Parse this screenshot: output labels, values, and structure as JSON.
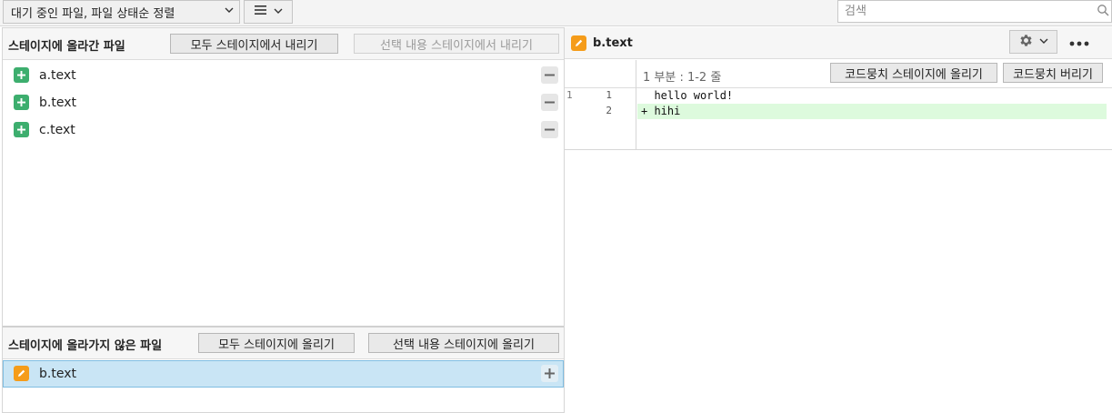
{
  "toolbar": {
    "sort_label": "대기 중인 파일, 파일 상태순 정렬",
    "view_icon_name": "list-icon",
    "search_placeholder": "검색"
  },
  "staged": {
    "title": "스테이지에 올라간 파일",
    "unstage_all_label": "모두 스테이지에서 내리기",
    "unstage_selected_label": "선택 내용 스테이지에서 내리기",
    "files": [
      {
        "name": "a.text",
        "status": "added"
      },
      {
        "name": "b.text",
        "status": "added"
      },
      {
        "name": "c.text",
        "status": "added"
      }
    ]
  },
  "unstaged": {
    "title": "스테이지에 올라가지 않은 파일",
    "stage_all_label": "모두 스테이지에 올리기",
    "stage_selected_label": "선택 내용 스테이지에 올리기",
    "files": [
      {
        "name": "b.text",
        "status": "modified",
        "selected": true
      }
    ]
  },
  "diff": {
    "file_name": "b.text",
    "hunk_label": "1 부분 : 1-2 줄",
    "stage_hunk_label": "코드뭉치 스테이지에 올리기",
    "discard_hunk_label": "코드뭉치 버리기",
    "lines": [
      {
        "old": "1",
        "new": "1",
        "text": "  hello world!",
        "type": "context"
      },
      {
        "old": "",
        "new": "2",
        "text": "+ hihi",
        "type": "added"
      }
    ]
  },
  "colors": {
    "added_icon": "#3dae6e",
    "modified_icon": "#f59c1a",
    "selection": "#c9e5f5",
    "added_line": "#ddfadd"
  }
}
